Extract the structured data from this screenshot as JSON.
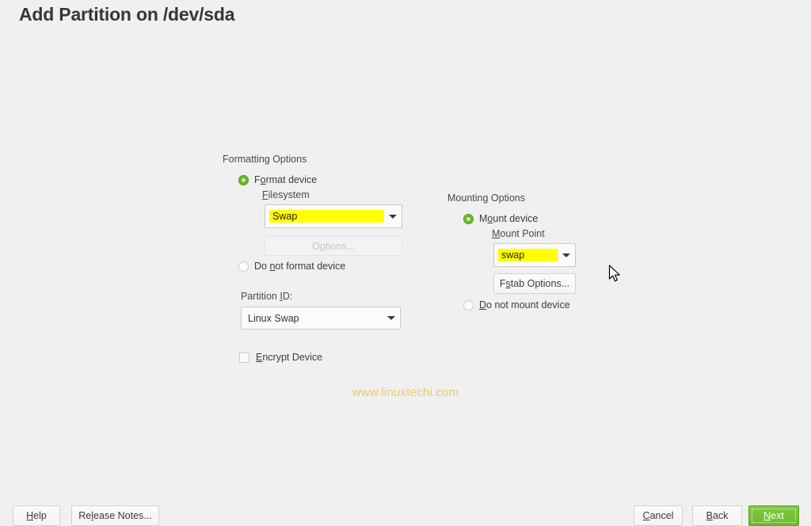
{
  "window": {
    "title": "Add Partition on /dev/sda",
    "background_color": "#f0f0f0"
  },
  "formatting": {
    "group_label": "Formatting Options",
    "format_device": {
      "label_pre": "F",
      "label_mnemonic": "o",
      "label_post": "rmat device",
      "selected": true
    },
    "filesystem": {
      "label_pre": "",
      "label_mnemonic": "F",
      "label_post": "ilesystem",
      "value": "Swap",
      "highlighted": true,
      "highlight_color": "#ffff00"
    },
    "options_button": {
      "label_pre": "O",
      "label_mnemonic": "p",
      "label_post": "tions...",
      "disabled": true
    },
    "do_not_format": {
      "label_pre": "Do ",
      "label_mnemonic": "n",
      "label_post": "ot format device",
      "selected": false
    },
    "partition_id": {
      "label_pre": "Partition ",
      "label_mnemonic": "I",
      "label_post": "D:",
      "value": "Linux Swap"
    },
    "encrypt_device": {
      "label_pre": "",
      "label_mnemonic": "E",
      "label_post": "ncrypt Device",
      "checked": false
    }
  },
  "mounting": {
    "group_label": "Mounting Options",
    "mount_device": {
      "label_pre": "M",
      "label_mnemonic": "o",
      "label_post": "unt device",
      "selected": true
    },
    "mount_point": {
      "label_pre": "",
      "label_mnemonic": "M",
      "label_post": "ount Point",
      "value": "swap",
      "highlighted": true,
      "highlight_color": "#ffff00"
    },
    "fstab_button": {
      "label_pre": "F",
      "label_mnemonic": "s",
      "label_post": "tab Options..."
    },
    "do_not_mount": {
      "label_pre": "",
      "label_mnemonic": "D",
      "label_post": "o not mount device",
      "selected": false
    }
  },
  "watermark": {
    "text": "www.linuxtechi.com",
    "color": "#e7c871"
  },
  "footer": {
    "help": {
      "label_pre": "",
      "label_mnemonic": "H",
      "label_post": "elp"
    },
    "release_notes": {
      "label_pre": "Re",
      "label_mnemonic": "l",
      "label_post": "ease Notes..."
    },
    "cancel": {
      "label_pre": "",
      "label_mnemonic": "C",
      "label_post": "ancel"
    },
    "back": {
      "label_pre": "",
      "label_mnemonic": "B",
      "label_post": "ack"
    },
    "next": {
      "label_pre": "",
      "label_mnemonic": "N",
      "label_post": "ext",
      "accent_color": "#6cbb2a",
      "focused": true
    }
  }
}
